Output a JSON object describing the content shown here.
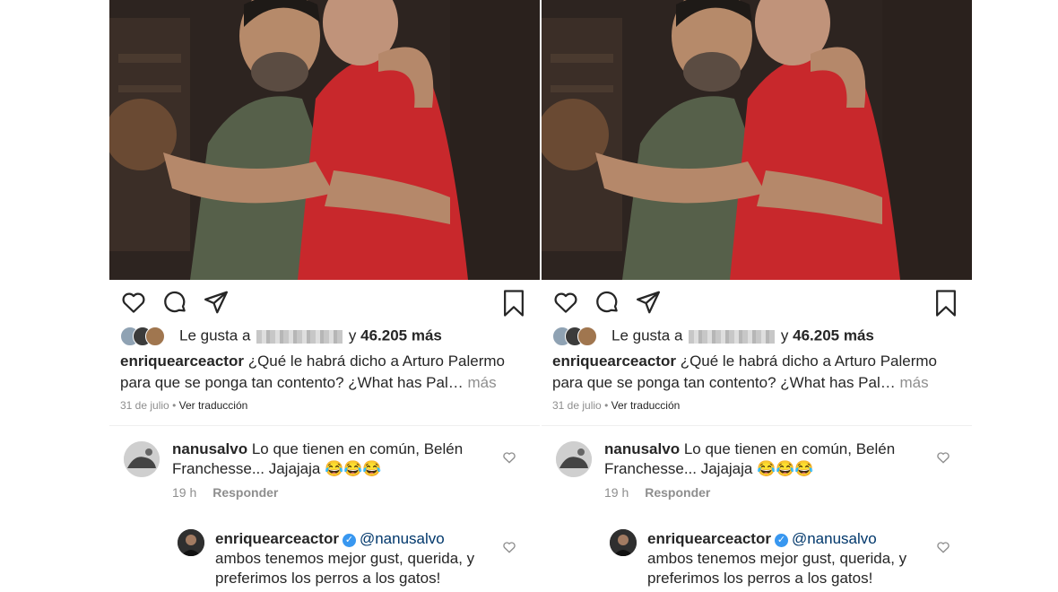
{
  "posts": [
    {
      "likes": {
        "prefix": "Le gusta a",
        "connector": "y",
        "count": "46.205 más"
      },
      "caption": {
        "user": "enriquearceactor",
        "text": "¿Qué le habrá dicho a Arturo Palermo para que se ponga tan contento? ¿What has Pal…",
        "more": "más"
      },
      "meta": {
        "date": "31 de julio",
        "sep": "•",
        "translate": "Ver traducción"
      },
      "comment": {
        "user": "nanusalvo",
        "text": "Lo que tienen en común, Belén Franchesse... Jajajaja 😂😂😂",
        "time": "19 h",
        "reply": "Responder"
      },
      "reply_comment": {
        "user": "enriquearceactor",
        "verified": "✓",
        "mention": "@nanusalvo",
        "text": "ambos tenemos mejor gust, querida, y preferimos los perros a los gatos!"
      }
    },
    {
      "likes": {
        "prefix": "Le gusta a",
        "connector": "y",
        "count": "46.205 más"
      },
      "caption": {
        "user": "enriquearceactor",
        "text": "¿Qué le habrá dicho a Arturo Palermo para que se ponga tan contento? ¿What has Pal…",
        "more": "más"
      },
      "meta": {
        "date": "31 de julio",
        "sep": "•",
        "translate": "Ver traducción"
      },
      "comment": {
        "user": "nanusalvo",
        "text": "Lo que tienen en común, Belén Franchesse... Jajajaja 😂😂😂",
        "time": "19 h",
        "reply": "Responder"
      },
      "reply_comment": {
        "user": "enriquearceactor",
        "verified": "✓",
        "mention": "@nanusalvo",
        "text": "ambos tenemos mejor gust, querida, y preferimos los perros a los gatos!"
      }
    }
  ],
  "icons": [
    "heart-icon",
    "comment-icon",
    "share-icon",
    "bookmark-icon"
  ],
  "colors": {
    "text": "#262626",
    "muted": "#8e8e8e",
    "verified": "#3897f0",
    "mention": "#00376b"
  }
}
